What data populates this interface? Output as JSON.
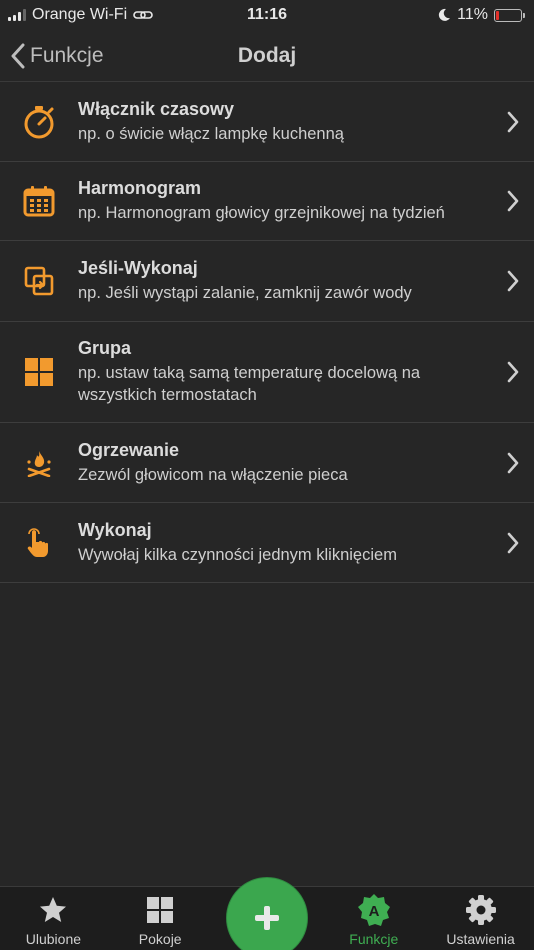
{
  "status_bar": {
    "carrier": "Orange Wi-Fi",
    "time": "11:16",
    "battery_percent": "11%",
    "battery_level": 0.11
  },
  "nav": {
    "back_label": "Funkcje",
    "title": "Dodaj"
  },
  "items": [
    {
      "icon": "stopwatch-icon",
      "title": "Włącznik czasowy",
      "subtitle": "np. o świcie włącz lampkę kuchenną"
    },
    {
      "icon": "calendar-icon",
      "title": "Harmonogram",
      "subtitle": "np. Harmonogram głowicy grzejnikowej na tydzień"
    },
    {
      "icon": "if-then-icon",
      "title": "Jeśli-Wykonaj",
      "subtitle": "np. Jeśli wystąpi zalanie, zamknij zawór wody"
    },
    {
      "icon": "group-icon",
      "title": "Grupa",
      "subtitle": "np. ustaw taką samą temperaturę docelową na wszystkich termostatach"
    },
    {
      "icon": "flame-icon",
      "title": "Ogrzewanie",
      "subtitle": "Zezwól głowicom na włączenie pieca"
    },
    {
      "icon": "tap-icon",
      "title": "Wykonaj",
      "subtitle": "Wywołaj kilka czynności jednym kliknięciem"
    }
  ],
  "tabs": [
    {
      "icon": "star-icon",
      "label": "Ulubione",
      "active": false
    },
    {
      "icon": "rooms-icon",
      "label": "Pokoje",
      "active": false
    },
    {
      "icon": "plus-icon",
      "label": "",
      "active": false
    },
    {
      "icon": "functions-icon",
      "label": "Funkcje",
      "active": true
    },
    {
      "icon": "gear-icon",
      "label": "Ustawienia",
      "active": false
    }
  ],
  "colors": {
    "accent_orange": "#f29a2e",
    "accent_green": "#3fae52",
    "background": "#262626"
  }
}
